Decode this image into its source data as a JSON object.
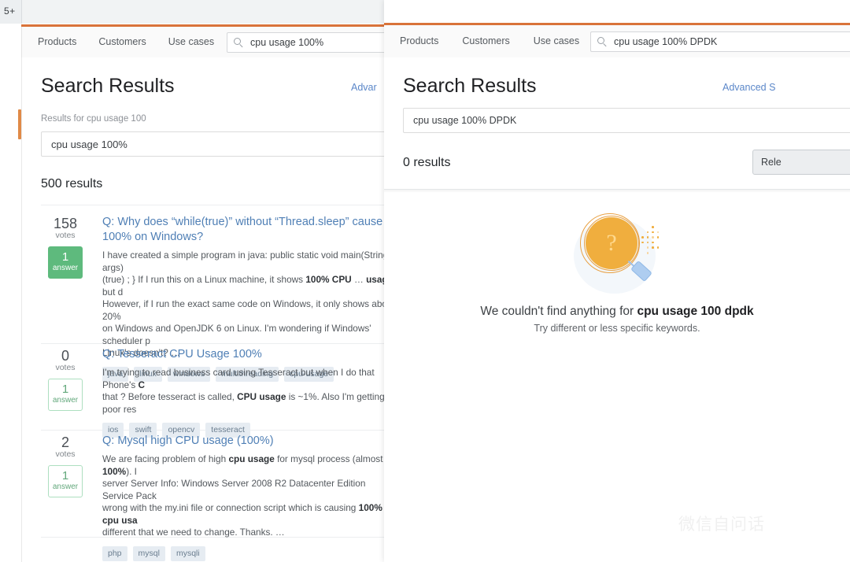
{
  "left_window": {
    "browser": {
      "tab_count_label": "5+"
    },
    "nav": {
      "links": [
        "Products",
        "Customers",
        "Use cases"
      ],
      "search_value": "cpu usage 100%",
      "search_icon": "search-icon"
    },
    "page_title": "Search Results",
    "advanced_search_label": "Advar",
    "results_for_label": "Results for cpu usage 100",
    "query_value": "cpu usage 100%",
    "result_count_label": "500 results",
    "results": [
      {
        "votes": "158",
        "votes_label": "votes",
        "answers": "1",
        "answers_label": "answer",
        "answer_accepted": true,
        "title": "Q: Why does “while(true)” without “Thread.sleep” cause 100% on Windows?",
        "excerpt_html": "I have created a simple program in java: public static void main(String[] args)\n(true) ; } If I run this on a Linux machine, it shows <b>100% CPU</b> … <b>usage</b>, but d\nHowever, if I run the exact same code on Windows, it only shows about 20%\non Windows and OpenJDK 6 on Linux. I'm wondering if Windows' scheduler p\nLinux's doesn't? …",
        "tags": [
          "java",
          "linux",
          "windows",
          "multithreading",
          "cpu-usage"
        ]
      },
      {
        "votes": "0",
        "votes_label": "votes",
        "answers": "1",
        "answers_label": "answer",
        "answer_accepted": false,
        "title": "Q: Tesseract CPU Usage 100%",
        "excerpt_html": "I'm trying to read business card using Tesseract but when I do that Phone's <b>C</b>\nthat ? Before tesseract is called, <b>CPU usage</b> is ~1%. Also I'm getting poor res",
        "tags": [
          "ios",
          "swift",
          "opencv",
          "tesseract"
        ]
      },
      {
        "votes": "2",
        "votes_label": "votes",
        "answers": "1",
        "answers_label": "answer",
        "answer_accepted": false,
        "title": "Q: Mysql high CPU usage (100%)",
        "excerpt_html": "We are facing problem of high <b>cpu usage</b> for mysql process (almost <b>100%</b>). I\nserver Server Info: Windows Server 2008 R2 Datacenter Edition Service Pack\nwrong with the my.ini file or connection script which is causing <b>100% cpu usa</b>\ndifferent that we need to change. Thanks. …",
        "tags": [
          "php",
          "mysql",
          "mysqli"
        ]
      }
    ]
  },
  "right_window": {
    "nav": {
      "links": [
        "Products",
        "Customers",
        "Use cases"
      ],
      "search_value": "cpu usage 100% DPDK",
      "search_icon": "search-icon"
    },
    "page_title": "Search Results",
    "advanced_search_label": "Advanced S",
    "query_value": "cpu usage 100% DPDK",
    "result_count_label": "0 results",
    "sort_button_label": "Rele",
    "empty_state": {
      "illustration": "magnifier-question-icon",
      "question_mark": "?",
      "message_prefix": "We couldn't find anything for ",
      "message_query": "cpu usage 100 dpdk",
      "hint": "Try different or less specific keywords."
    }
  },
  "watermark": {
    "text": "微信自问话"
  },
  "theme": {
    "accent_orange": "#d9733a",
    "link_blue": "#4f7fb5",
    "answer_green": "#5eba7d",
    "illustration_amber": "#f0ae3e",
    "illustration_blue": "#aecdf0"
  }
}
